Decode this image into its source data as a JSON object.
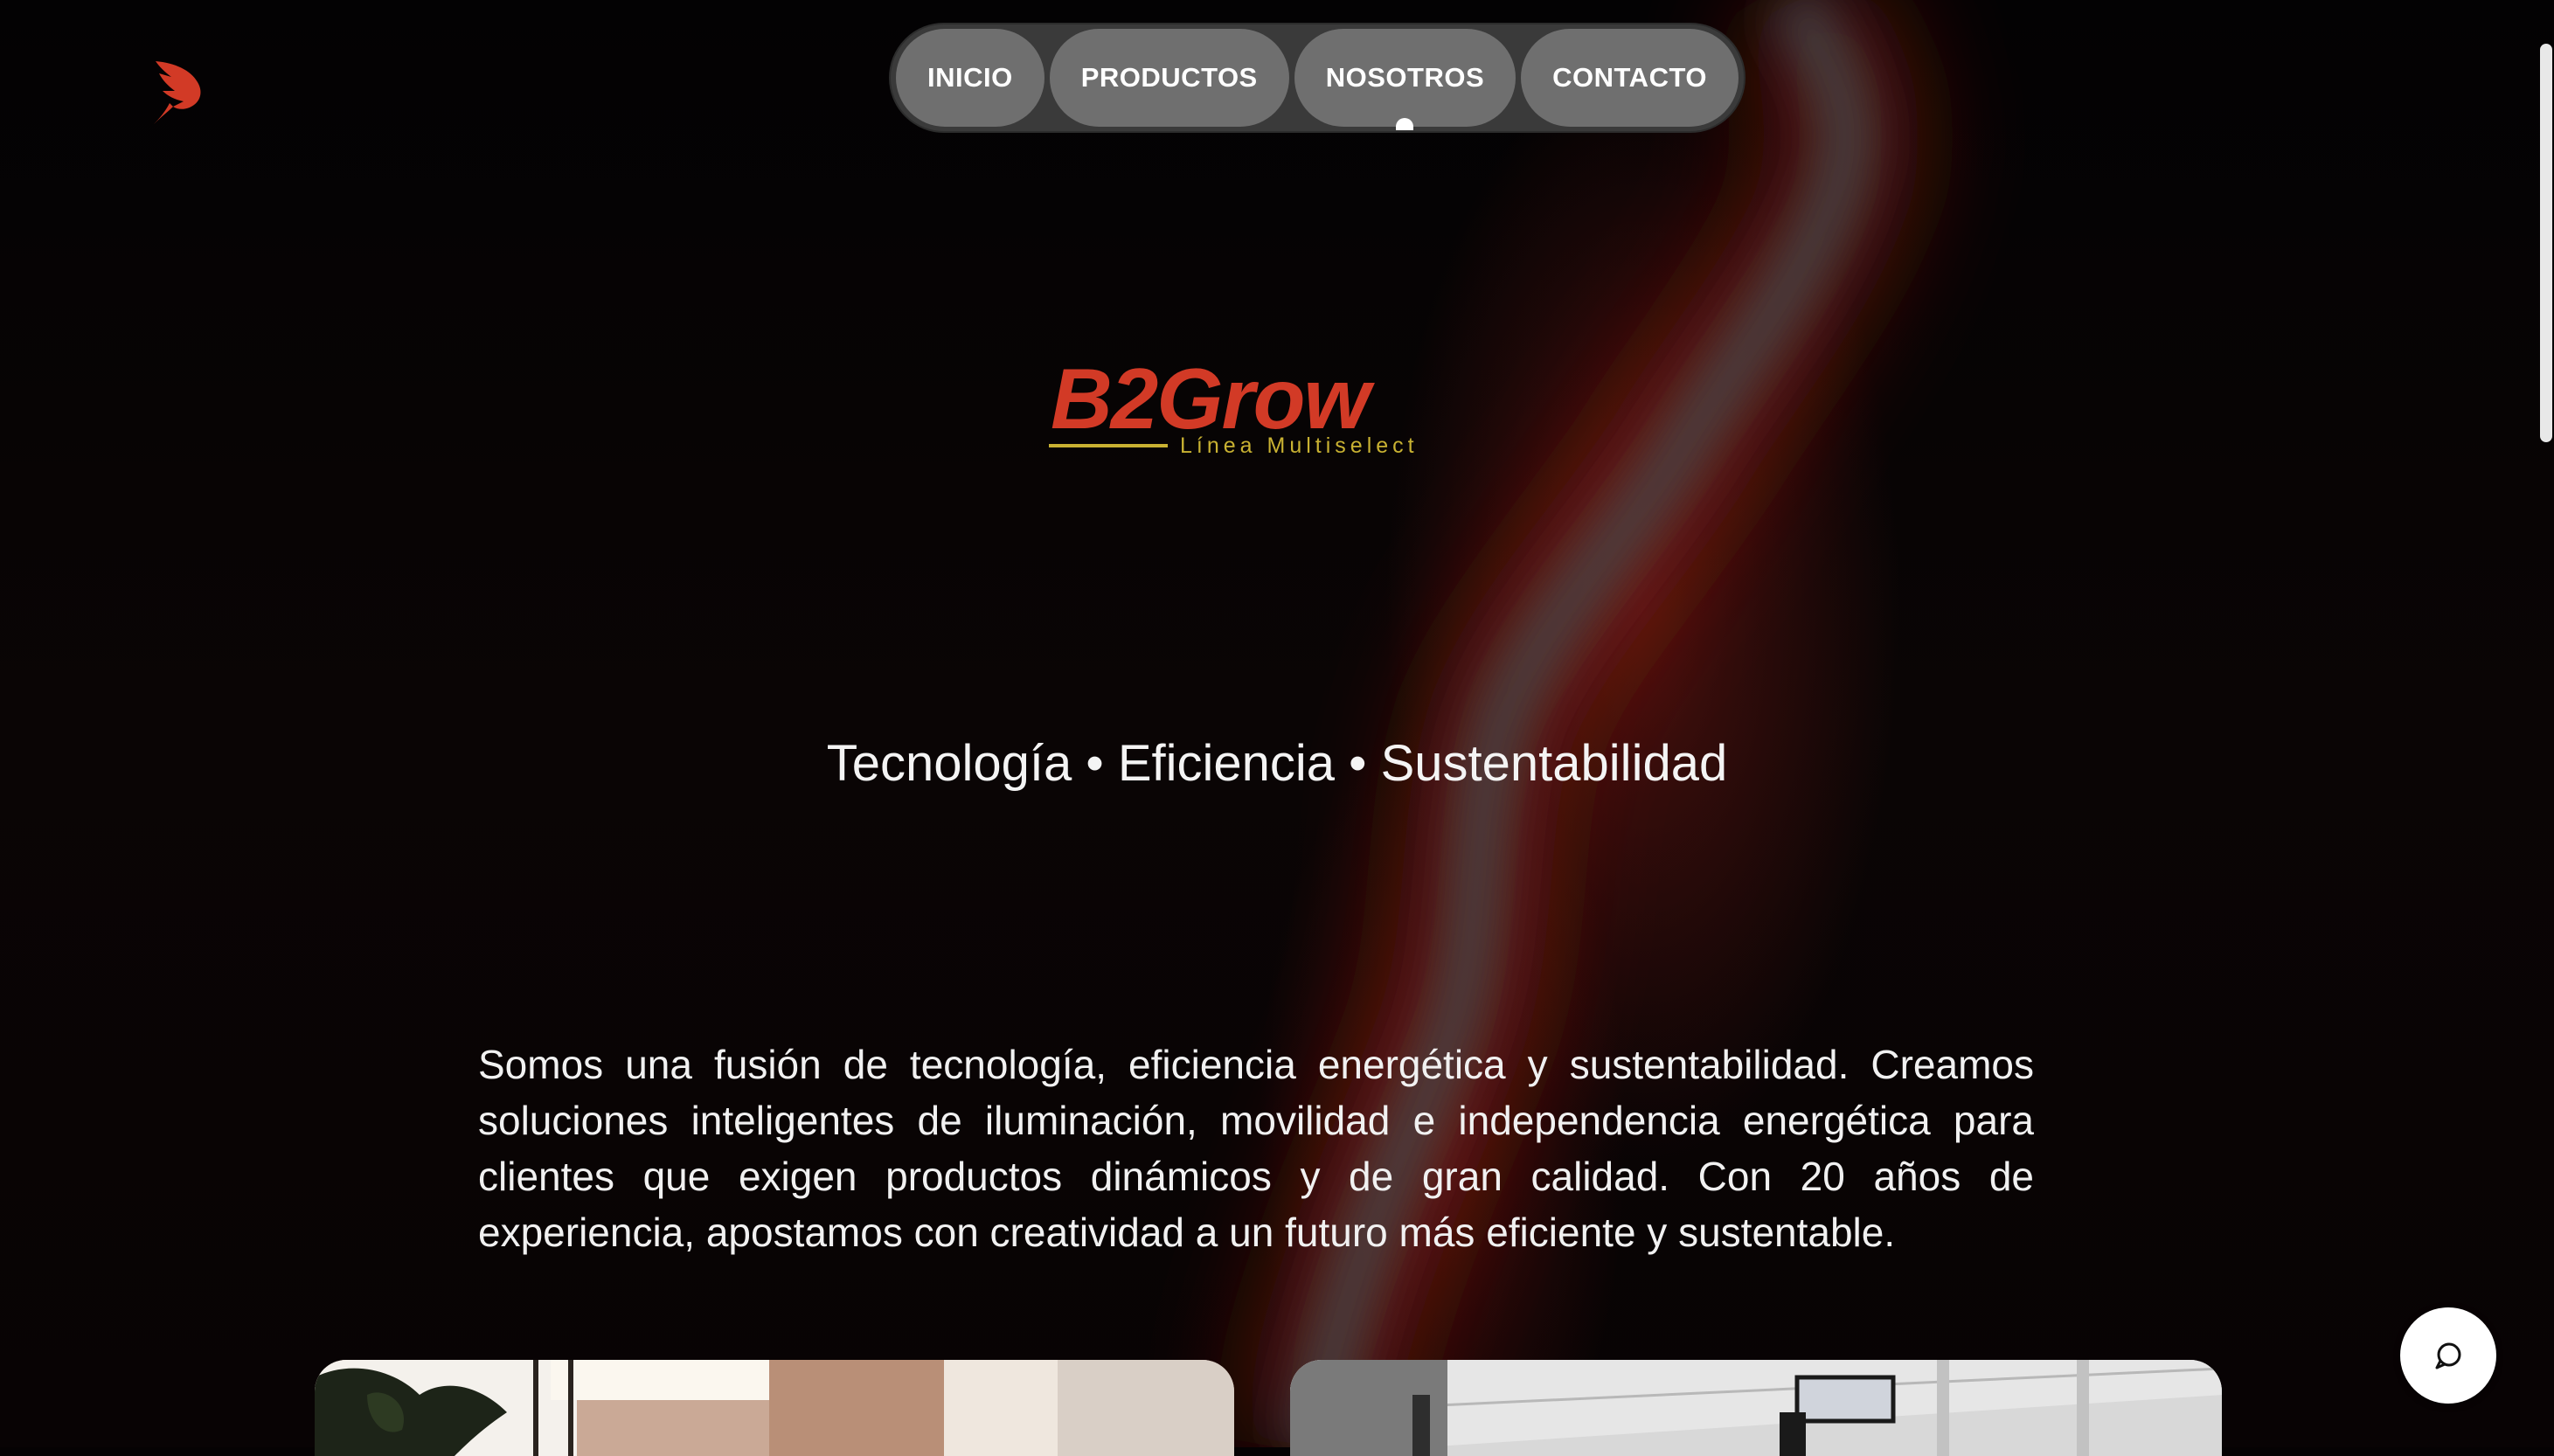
{
  "nav": {
    "items": [
      {
        "label": "INICIO"
      },
      {
        "label": "PRODUCTOS"
      },
      {
        "label": "NOSOTROS",
        "active": true
      },
      {
        "label": "CONTACTO"
      }
    ]
  },
  "logo": {
    "wordmark": "B2Grow",
    "subtitle": "Línea Multiselect",
    "color": "#d23a26",
    "accent": "#c9b232"
  },
  "hero": {
    "tagline": "Tecnología • Eficiencia • Sustentabilidad"
  },
  "about": {
    "text": "Somos una fusión de tecnología, eficiencia energética y sustentabilidad. Creamos soluciones inteligentes de iluminación, movilidad e independencia energética para clientes que exigen productos dinámicos y de gran calidad. Con 20 años de experiencia, apostamos con creatividad a un futuro más eficiente y sustentable."
  },
  "icons": {
    "brand": "bird-logo-icon",
    "chat": "chat-bubble-icon"
  },
  "colors": {
    "brand_red": "#d23a26",
    "nav_pill": "#6f6f6f"
  }
}
